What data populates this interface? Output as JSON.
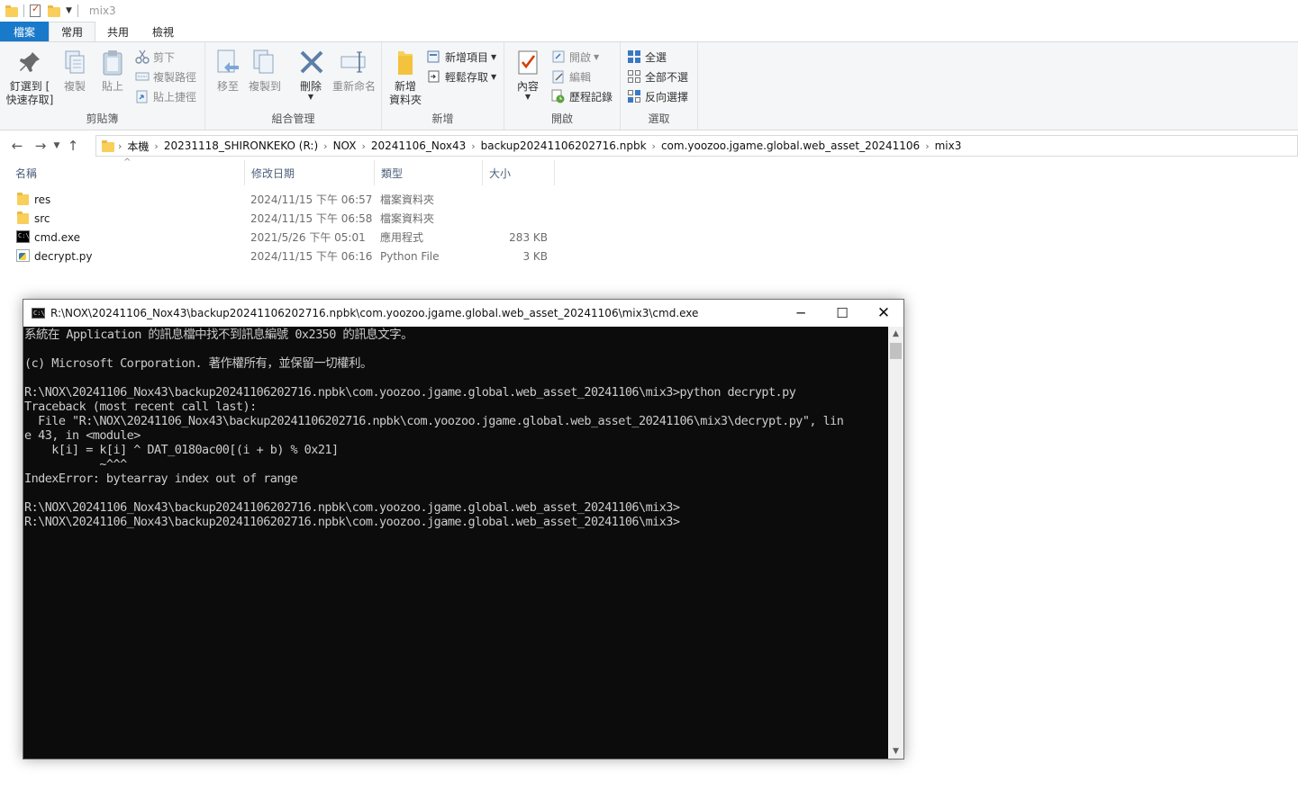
{
  "window": {
    "title": "mix3"
  },
  "tabs": [
    {
      "label": "檔案"
    },
    {
      "label": "常用"
    },
    {
      "label": "共用"
    },
    {
      "label": "檢視"
    }
  ],
  "ribbon": {
    "clipboard": {
      "group_label": "剪貼簿",
      "pin": "釘選到 [\n快速存取]",
      "copy": "複製",
      "paste": "貼上",
      "cut": "剪下",
      "copy_path": "複製路徑",
      "paste_shortcut": "貼上捷徑"
    },
    "organize": {
      "group_label": "組合管理",
      "move_to": "移至",
      "copy_to": "複製到",
      "delete": "刪除",
      "rename": "重新命名"
    },
    "new": {
      "group_label": "新增",
      "new_folder": "新增\n資料夾",
      "new_item": "新增項目",
      "easy_access": "輕鬆存取"
    },
    "open": {
      "group_label": "開啟",
      "properties": "內容",
      "open": "開啟",
      "edit": "編輯",
      "history": "歷程記錄"
    },
    "select": {
      "group_label": "選取",
      "select_all": "全選",
      "select_none": "全部不選",
      "invert": "反向選擇"
    }
  },
  "address": {
    "crumbs": [
      "本機",
      "20231118_SHIRONKEKO (R:)",
      "NOX",
      "20241106_Nox43",
      "backup20241106202716.npbk",
      "com.yoozoo.jgame.global.web_asset_20241106",
      "mix3"
    ]
  },
  "columns": {
    "name": "名稱",
    "date": "修改日期",
    "type": "類型",
    "size": "大小"
  },
  "files": [
    {
      "name": "res",
      "date": "2024/11/15 下午 06:57",
      "type": "檔案資料夾",
      "size": "",
      "icon": "folder-icon"
    },
    {
      "name": "src",
      "date": "2024/11/15 下午 06:58",
      "type": "檔案資料夾",
      "size": "",
      "icon": "folder-icon"
    },
    {
      "name": "cmd.exe",
      "date": "2021/5/26 下午 05:01",
      "type": "應用程式",
      "size": "283 KB",
      "icon": "console-app-icon"
    },
    {
      "name": "decrypt.py",
      "date": "2024/11/15 下午 06:16",
      "type": "Python File",
      "size": "3 KB",
      "icon": "python-file-icon"
    }
  ],
  "console": {
    "title": "R:\\NOX\\20241106_Nox43\\backup20241106202716.npbk\\com.yoozoo.jgame.global.web_asset_20241106\\mix3\\cmd.exe",
    "lines": [
      "系統在 Application 的訊息檔中找不到訊息編號 0x2350 的訊息文字。",
      "",
      "(c) Microsoft Corporation. 著作權所有，並保留一切權利。",
      "",
      "R:\\NOX\\20241106_Nox43\\backup20241106202716.npbk\\com.yoozoo.jgame.global.web_asset_20241106\\mix3>python decrypt.py",
      "Traceback (most recent call last):",
      "  File \"R:\\NOX\\20241106_Nox43\\backup20241106202716.npbk\\com.yoozoo.jgame.global.web_asset_20241106\\mix3\\decrypt.py\", lin",
      "e 43, in <module>",
      "    k[i] = k[i] ^ DAT_0180ac00[(i + b) % 0x21]",
      "           ~^^^",
      "IndexError: bytearray index out of range",
      "",
      "R:\\NOX\\20241106_Nox43\\backup20241106202716.npbk\\com.yoozoo.jgame.global.web_asset_20241106\\mix3>",
      "R:\\NOX\\20241106_Nox43\\backup20241106202716.npbk\\com.yoozoo.jgame.global.web_asset_20241106\\mix3>"
    ]
  }
}
